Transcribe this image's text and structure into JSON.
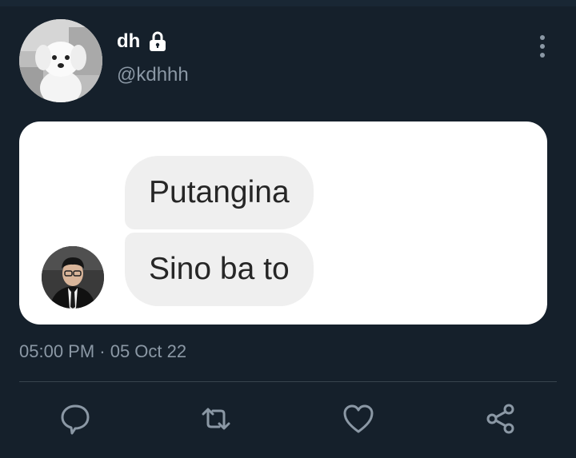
{
  "tweet": {
    "display_name": "dh",
    "handle": "@kdhhh",
    "timestamp": "05:00 PM · 05 Oct 22",
    "protected_icon": "lock-icon",
    "more_icon": "more-vertical-icon"
  },
  "media": {
    "messages": [
      {
        "text": "Putangina"
      },
      {
        "text": "Sino ba to"
      }
    ]
  },
  "actions": [
    {
      "name": "reply",
      "icon": "reply-icon"
    },
    {
      "name": "retweet",
      "icon": "retweet-icon"
    },
    {
      "name": "like",
      "icon": "heart-icon"
    },
    {
      "name": "share",
      "icon": "share-icon"
    }
  ],
  "colors": {
    "background": "#15202b",
    "secondary_text": "#8b98a5",
    "divider": "#38444d",
    "card": "#ffffff",
    "bubble": "#efefef"
  }
}
